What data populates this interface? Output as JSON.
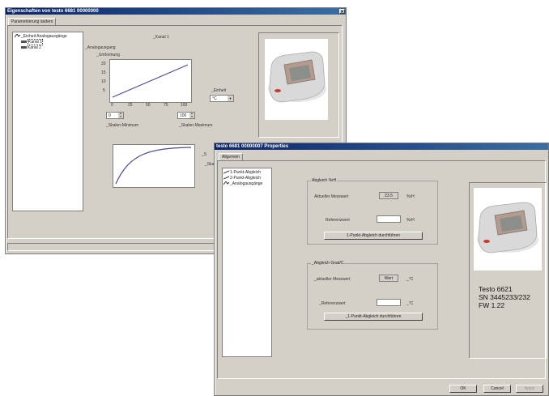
{
  "back_window": {
    "title": "Eigenschaften von testo 6681 00000000",
    "tab": "Parametrierung ändern",
    "tree": [
      "_Einheit Analogausgänge",
      "Kanal 1",
      "Kanal 2"
    ],
    "channel_heading": "_Kanal 1",
    "analog_label": "_Analogausgang",
    "chart_label": "_Umformung",
    "y_ticks": [
      "20",
      "15",
      "10",
      "5"
    ],
    "x_ticks": [
      "0",
      "25",
      "50",
      "75",
      "100"
    ],
    "unit_label": "_Einheit",
    "unit_value": "°C",
    "min_value": "0",
    "max_value": "100",
    "min_label": "_Skalen-Minimum",
    "max_label": "_Skalen-Maximum",
    "partial_labels": [
      "_S",
      "_Ska"
    ]
  },
  "front_window": {
    "title": "testo 6681 00000007 Properties",
    "tab": "Allgemein",
    "tree": [
      "1-Punkt-Abgleich",
      "2-Punkt-Abgleich",
      "_Analogausgänge"
    ],
    "group1": {
      "title": "Abgleich %rH",
      "measured_label": "Aktueller Messwert",
      "measured_value": "23.5",
      "measured_unit": "%rH",
      "reference_label": "Referenzwert",
      "reference_unit": "%rH",
      "button": "1-Punkt-Abgleich durchführen"
    },
    "group2": {
      "title": "_Abgleich Grad/C",
      "measured_label": "_aktueller Messwert",
      "measured_value": "Wert",
      "measured_unit": "_°C",
      "reference_label": "_Referenzwert",
      "reference_unit": "_°C",
      "button": "_1-Punkt-Abgleich durchführen"
    },
    "device_info": [
      "Testo 6621",
      "SN 3445233/232",
      "FW 1.22"
    ],
    "buttons": {
      "ok": "OK",
      "cancel": "Cancel",
      "apply": "Apply"
    }
  },
  "colors": {
    "titlebar": "#0a246a",
    "face": "#d4d0c8",
    "curve": "#4a4aa8"
  }
}
